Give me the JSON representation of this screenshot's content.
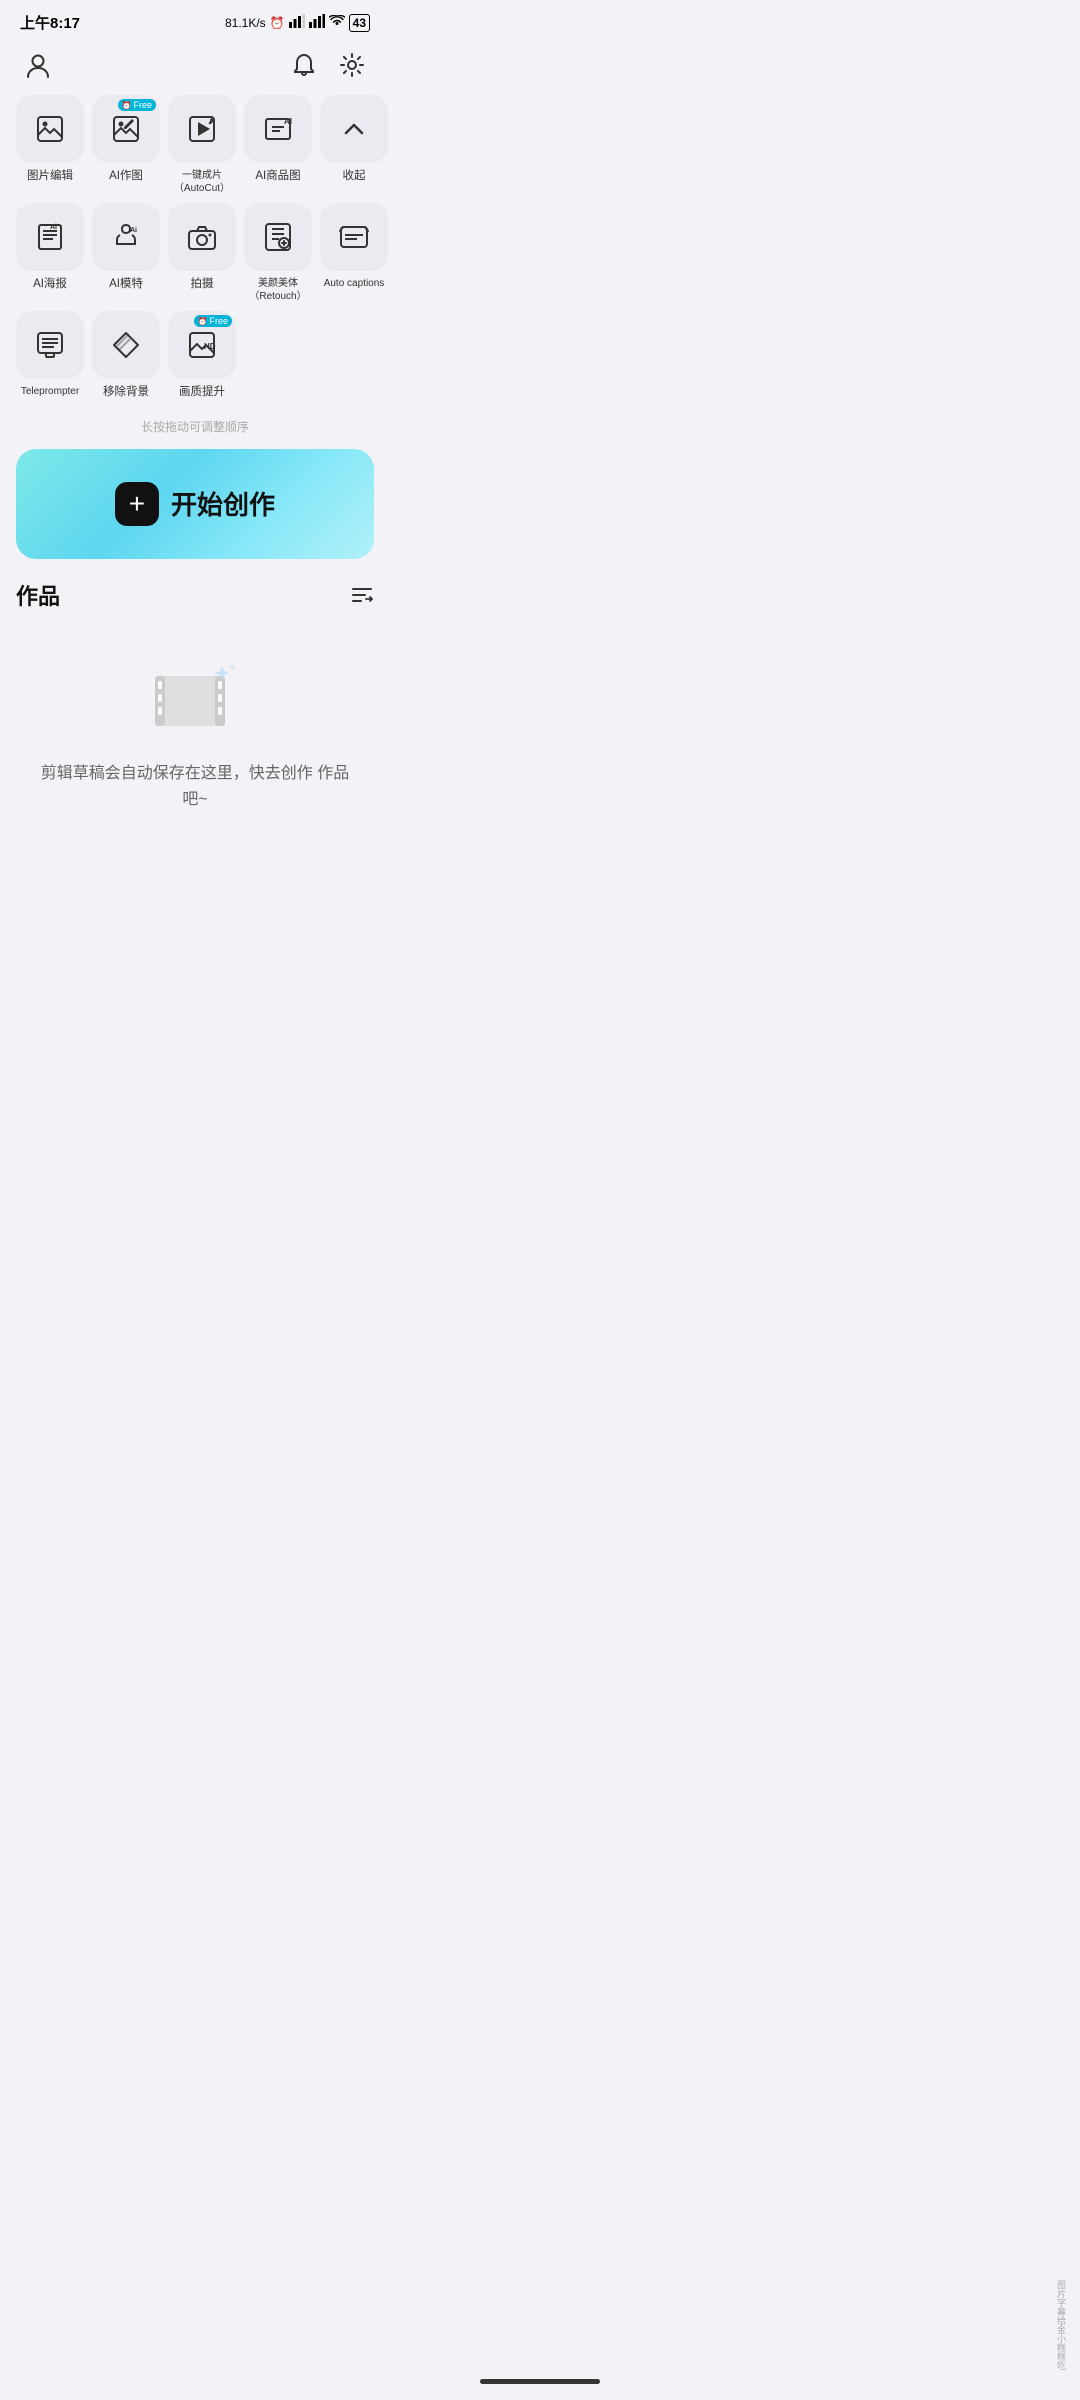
{
  "statusBar": {
    "time": "上午8:17",
    "speed": "81.1K/s",
    "battery": "43"
  },
  "nav": {
    "userIcon": "user",
    "bellIcon": "bell",
    "settingsIcon": "settings"
  },
  "toolsRows": [
    [
      {
        "id": "image-edit",
        "label": "图片编辑",
        "icon": "image-edit",
        "free": false
      },
      {
        "id": "ai-draw",
        "label": "AI作图",
        "icon": "ai-draw",
        "free": true
      },
      {
        "id": "autocut",
        "label": "一键成片\n（AutoCut）",
        "icon": "autocut",
        "free": false
      },
      {
        "id": "ai-product",
        "label": "AI商品图",
        "icon": "ai-product",
        "free": false
      },
      {
        "id": "collapse",
        "label": "收起",
        "icon": "collapse",
        "free": false
      }
    ],
    [
      {
        "id": "ai-poster",
        "label": "AI海报",
        "icon": "ai-poster",
        "free": false
      },
      {
        "id": "ai-model",
        "label": "AI模特",
        "icon": "ai-model",
        "free": false
      },
      {
        "id": "camera",
        "label": "拍摄",
        "icon": "camera",
        "free": false
      },
      {
        "id": "retouch",
        "label": "美颜美体\n（Retouch）",
        "icon": "retouch",
        "free": false
      },
      {
        "id": "captions",
        "label": "Auto captions",
        "icon": "captions",
        "free": false
      }
    ],
    [
      {
        "id": "teleprompter",
        "label": "Teleprompter",
        "icon": "teleprompter",
        "free": false
      },
      {
        "id": "remove-bg",
        "label": "移除背景",
        "icon": "remove-bg",
        "free": false
      },
      {
        "id": "hd-enhance",
        "label": "画质提升",
        "icon": "hd-enhance",
        "free": true
      }
    ]
  ],
  "dragHint": "长按拖动可调整顺序",
  "startButton": {
    "plusLabel": "+",
    "label": "开始创作"
  },
  "works": {
    "title": "作品",
    "emptyText": "剪辑草稿会自动保存在这里，快去创作\n作品吧~"
  },
  "watermark": "图片字幕给金小糕糕吃"
}
